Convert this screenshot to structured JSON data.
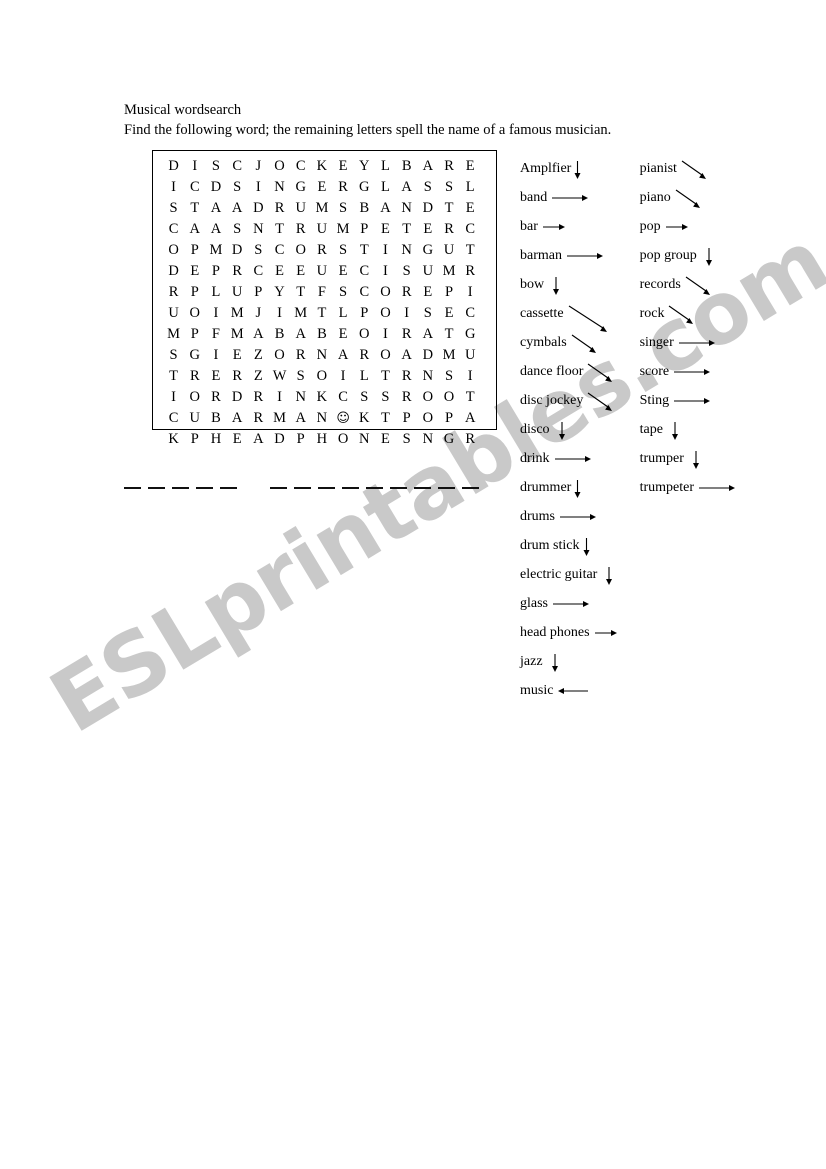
{
  "document": {
    "title_line": "Musical wordsearch",
    "instruction_line": "Find the following word; the remaining letters spell the name of a famous musician.",
    "watermark": "ESLprintables.com"
  },
  "grid": {
    "columns": 15,
    "rows": 14,
    "letters": [
      [
        "D",
        "I",
        "S",
        "C",
        "J",
        "O",
        "C",
        "K",
        "E",
        "Y",
        "L",
        "B",
        "A",
        "R",
        "E"
      ],
      [
        "I",
        "C",
        "D",
        "S",
        "I",
        "N",
        "G",
        "E",
        "R",
        "G",
        "L",
        "A",
        "S",
        "S",
        "L"
      ],
      [
        "S",
        "T",
        "A",
        "A",
        "D",
        "R",
        "U",
        "M",
        "S",
        "B",
        "A",
        "N",
        "D",
        "T",
        "E"
      ],
      [
        "C",
        "A",
        "A",
        "S",
        "N",
        "T",
        "R",
        "U",
        "M",
        "P",
        "E",
        "T",
        "E",
        "R",
        "C"
      ],
      [
        "O",
        "P",
        "M",
        "D",
        "S",
        "C",
        "O",
        "R",
        "S",
        "T",
        "I",
        "N",
        "G",
        "U",
        "T"
      ],
      [
        "D",
        "E",
        "P",
        "R",
        "C",
        "E",
        "E",
        "U",
        "E",
        "C",
        "I",
        "S",
        "U",
        "M",
        "R"
      ],
      [
        "R",
        "P",
        "L",
        "U",
        "P",
        "Y",
        "T",
        "F",
        "S",
        "C",
        "O",
        "R",
        "E",
        "P",
        "I"
      ],
      [
        "U",
        "O",
        "I",
        "M",
        "J",
        "I",
        "M",
        "T",
        "L",
        "P",
        "O",
        "I",
        "S",
        "E",
        "C"
      ],
      [
        "M",
        "P",
        "F",
        "M",
        "A",
        "B",
        "A",
        "B",
        "E",
        "O",
        "I",
        "R",
        "A",
        "T",
        "G"
      ],
      [
        "S",
        "G",
        "I",
        "E",
        "Z",
        "O",
        "R",
        "N",
        "A",
        "R",
        "O",
        "A",
        "D",
        "M",
        "U"
      ],
      [
        "T",
        "R",
        "E",
        "R",
        "Z",
        "W",
        "S",
        "O",
        "I",
        "L",
        "T",
        "R",
        "N",
        "S",
        "I"
      ],
      [
        "I",
        "O",
        "R",
        "D",
        "R",
        "I",
        "N",
        "K",
        "C",
        "S",
        "S",
        "R",
        "O",
        "O",
        "T"
      ],
      [
        "C",
        "U",
        "B",
        "A",
        "R",
        "M",
        "A",
        "N",
        "☺",
        "K",
        "T",
        "P",
        "O",
        "P",
        "A"
      ],
      [
        "K",
        "P",
        "H",
        "E",
        "A",
        "D",
        "P",
        "H",
        "O",
        "N",
        "E",
        "S",
        "N",
        "G",
        "R"
      ]
    ]
  },
  "answer_blanks": {
    "group_1_count": 5,
    "group_2_count": 9
  },
  "word_list": {
    "column_1": [
      {
        "word": "Amplfier",
        "arrow": "down-tight"
      },
      {
        "word": "band",
        "arrow": "right"
      },
      {
        "word": "bar",
        "arrow": "right-short"
      },
      {
        "word": "barman",
        "arrow": "right"
      },
      {
        "word": "bow",
        "arrow": "down"
      },
      {
        "word": "cassette",
        "arrow": "diag-long"
      },
      {
        "word": "cymbals",
        "arrow": "diag"
      },
      {
        "word": "dance floor",
        "arrow": "diag"
      },
      {
        "word": "disc jockey",
        "arrow": "diag"
      },
      {
        "word": "disco",
        "arrow": "down"
      },
      {
        "word": "drink",
        "arrow": "right"
      },
      {
        "word": "drummer",
        "arrow": "down-tight"
      },
      {
        "word": "drums",
        "arrow": "right"
      },
      {
        "word": "drum stick",
        "arrow": "down-tight"
      },
      {
        "word": "electric guitar",
        "arrow": "down"
      },
      {
        "word": "glass",
        "arrow": "right"
      },
      {
        "word": "head phones",
        "arrow": "right-short"
      },
      {
        "word": "jazz",
        "arrow": "down"
      },
      {
        "word": "music",
        "arrow": "left"
      }
    ],
    "column_2": [
      {
        "word": "pianist",
        "arrow": "diag"
      },
      {
        "word": "piano",
        "arrow": "diag"
      },
      {
        "word": "pop",
        "arrow": "right-short"
      },
      {
        "word": "pop group",
        "arrow": "down"
      },
      {
        "word": "records",
        "arrow": "diag"
      },
      {
        "word": "rock",
        "arrow": "diag"
      },
      {
        "word": "singer",
        "arrow": "right"
      },
      {
        "word": "score",
        "arrow": "right"
      },
      {
        "word": "Sting",
        "arrow": "right"
      },
      {
        "word": "tape",
        "arrow": "down"
      },
      {
        "word": "trumper",
        "arrow": "down"
      },
      {
        "word": "trumpeter",
        "arrow": "right"
      }
    ]
  }
}
